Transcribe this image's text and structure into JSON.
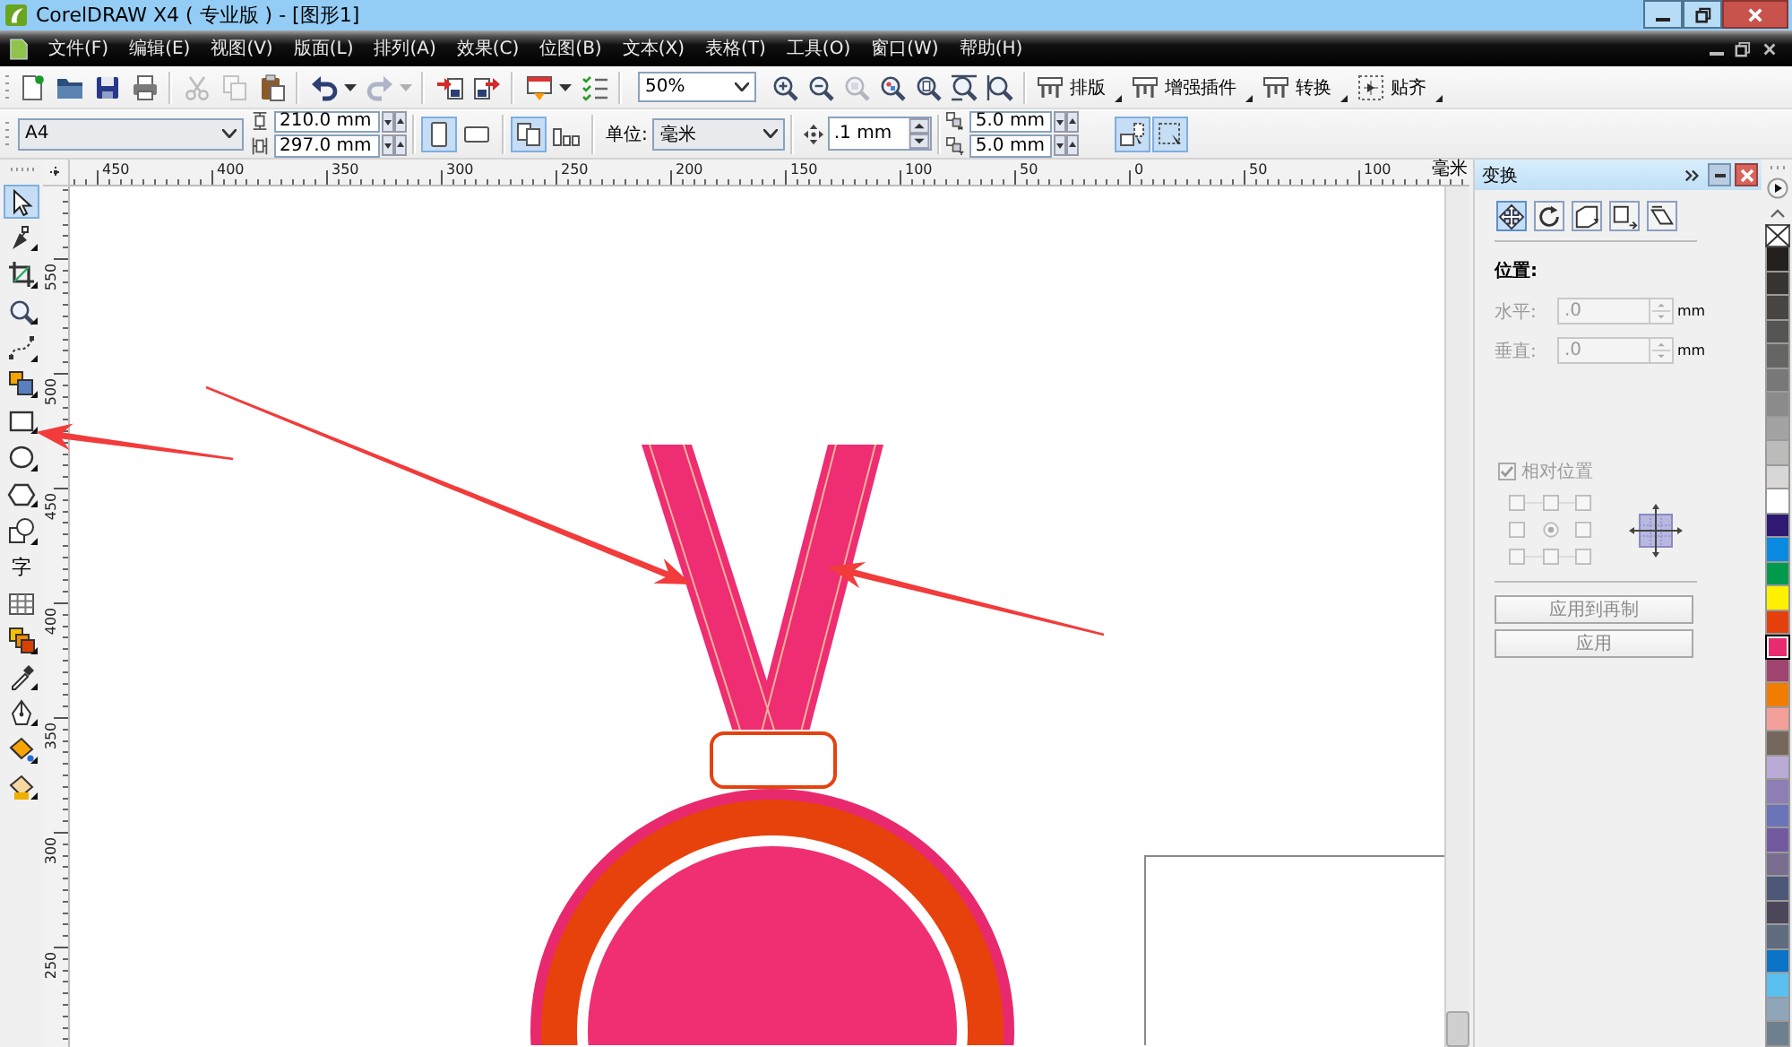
{
  "window": {
    "title": "CorelDRAW X4 ( 专业版 ) - [图形1]"
  },
  "menu_bar": {
    "items": [
      "文件(F)",
      "编辑(E)",
      "视图(V)",
      "版面(L)",
      "排列(A)",
      "效果(C)",
      "位图(B)",
      "文本(X)",
      "表格(T)",
      "工具(O)",
      "窗口(W)",
      "帮助(H)"
    ]
  },
  "standard_toolbar": {
    "groups": [
      [
        {
          "kind": "new",
          "disabled": false
        },
        {
          "kind": "open",
          "disabled": false
        },
        {
          "kind": "save",
          "disabled": false
        },
        {
          "kind": "print",
          "disabled": false
        }
      ],
      [
        {
          "kind": "cut",
          "disabled": true
        },
        {
          "kind": "copy",
          "disabled": true
        },
        {
          "kind": "paste",
          "disabled": false
        }
      ],
      [
        {
          "kind": "undo",
          "disabled": false
        },
        {
          "kind": "menu-caret",
          "disabled": false
        },
        {
          "kind": "redo",
          "disabled": true
        },
        {
          "kind": "menu-caret",
          "disabled": true
        }
      ],
      [
        {
          "kind": "import",
          "disabled": false
        },
        {
          "kind": "export",
          "disabled": false
        }
      ],
      [
        {
          "kind": "launcher",
          "disabled": false
        },
        {
          "kind": "menu-caret",
          "disabled": false
        },
        {
          "kind": "options",
          "disabled": false
        }
      ]
    ],
    "zoom_level": "50%",
    "zoom_tools": [
      {
        "kind": "zoom-in",
        "disabled": false
      },
      {
        "kind": "zoom-out",
        "disabled": false
      },
      {
        "kind": "zoom-selected",
        "disabled": true
      },
      {
        "kind": "zoom-all",
        "disabled": false
      },
      {
        "kind": "zoom-page",
        "disabled": false
      },
      {
        "kind": "zoom-width",
        "disabled": false
      },
      {
        "kind": "zoom-height",
        "disabled": false
      }
    ],
    "commands": [
      {
        "kind": "toolbar",
        "label": "排版"
      },
      {
        "kind": "toolbar",
        "label": "增强插件"
      },
      {
        "kind": "toolbar",
        "label": "转换"
      },
      {
        "kind": "snap",
        "label": "贴齐"
      }
    ]
  },
  "property_bar": {
    "page_size": "A4",
    "page_width": "210.0 mm",
    "page_height": "297.0 mm",
    "orientation": [
      {
        "kind": "portrait",
        "selected": true
      },
      {
        "kind": "landscape",
        "selected": false
      }
    ],
    "page_layout": [
      {
        "kind": "all-pages",
        "selected": true
      },
      {
        "kind": "current-page",
        "selected": false
      }
    ],
    "unit_label": "单位:",
    "unit": "毫米",
    "nudge": ".1 mm",
    "duplicate_x": "5.0 mm",
    "duplicate_y": "5.0 mm",
    "toggles": [
      {
        "kind": "object",
        "on": true
      },
      {
        "kind": "selection",
        "on": true
      }
    ]
  },
  "toolbox": {
    "tools": [
      {
        "kind": "pick",
        "selected": true,
        "flyout": false
      },
      {
        "kind": "shape",
        "selected": false,
        "flyout": true
      },
      {
        "kind": "crop",
        "selected": false,
        "flyout": true
      },
      {
        "kind": "zoom",
        "selected": false,
        "flyout": true
      },
      {
        "kind": "freehand",
        "selected": false,
        "flyout": true
      },
      {
        "kind": "smart-fill",
        "selected": false,
        "flyout": true
      },
      {
        "kind": "rectangle",
        "selected": false,
        "flyout": true
      },
      {
        "kind": "ellipse",
        "selected": false,
        "flyout": true
      },
      {
        "kind": "polygon",
        "selected": false,
        "flyout": true
      },
      {
        "kind": "basic-shapes",
        "selected": false,
        "flyout": true
      },
      {
        "kind": "text",
        "glyph": "字",
        "selected": false,
        "flyout": false
      },
      {
        "kind": "table",
        "selected": false,
        "flyout": false
      },
      {
        "kind": "blend",
        "selected": false,
        "flyout": true
      },
      {
        "kind": "eyedropper",
        "selected": false,
        "flyout": true
      },
      {
        "kind": "outline",
        "selected": false,
        "flyout": true
      },
      {
        "kind": "fill",
        "selected": false,
        "flyout": true
      },
      {
        "kind": "interactive-fill",
        "selected": false,
        "flyout": true
      }
    ]
  },
  "horizontal_ruler": {
    "labels": [
      "450",
      "400",
      "350",
      "300",
      "250",
      "200",
      "150",
      "100",
      "50",
      "0",
      "50",
      "100"
    ],
    "unit": "毫米"
  },
  "vertical_ruler": {
    "labels": [
      "550",
      "500",
      "450",
      "400",
      "350",
      "300",
      "250"
    ]
  },
  "docker": {
    "title": "变换",
    "tabs": [
      {
        "kind": "position",
        "selected": true
      },
      {
        "kind": "rotate",
        "selected": false
      },
      {
        "kind": "scale",
        "selected": false
      },
      {
        "kind": "size",
        "selected": false
      },
      {
        "kind": "skew",
        "selected": false
      }
    ],
    "section_title": "位置:",
    "fields": [
      {
        "label": "水平:",
        "value": ".0",
        "unit": "mm",
        "disabled": true
      },
      {
        "label": "垂直:",
        "value": ".0",
        "unit": "mm",
        "disabled": true
      }
    ],
    "relative_position": {
      "label": "相对位置",
      "checked": true,
      "disabled": true
    },
    "anchors": [
      {
        "selected": false
      },
      {
        "selected": false
      },
      {
        "selected": false
      },
      {
        "selected": false
      },
      {
        "selected": true
      },
      {
        "selected": false
      },
      {
        "selected": false
      },
      {
        "selected": false
      },
      {
        "selected": false
      }
    ],
    "buttons": [
      {
        "label": "应用到再制",
        "disabled": true
      },
      {
        "label": "应用",
        "disabled": true
      }
    ]
  },
  "color_palette": {
    "swatches": [
      {
        "color": "#23201e",
        "selected": false
      },
      {
        "color": "#373432",
        "selected": false
      },
      {
        "color": "#474442",
        "selected": false
      },
      {
        "color": "#575553",
        "selected": false
      },
      {
        "color": "#676564",
        "selected": false
      },
      {
        "color": "#7a7877",
        "selected": false
      },
      {
        "color": "#8c8b8a",
        "selected": false
      },
      {
        "color": "#a4a3a2",
        "selected": false
      },
      {
        "color": "#bcbbba",
        "selected": false
      },
      {
        "color": "#d8d7d6",
        "selected": false
      },
      {
        "color": "#ffffff",
        "selected": false
      },
      {
        "color": "#2e1a72",
        "selected": false
      },
      {
        "color": "#0a8ae0",
        "selected": false
      },
      {
        "color": "#009a4c",
        "selected": false
      },
      {
        "color": "#fff100",
        "selected": false
      },
      {
        "color": "#e6400c",
        "selected": false
      },
      {
        "color": "#e82a6e",
        "selected": true
      },
      {
        "color": "#a0436e",
        "selected": false
      },
      {
        "color": "#f07d00",
        "selected": false
      },
      {
        "color": "#f4a09a",
        "selected": false
      },
      {
        "color": "#75675c",
        "selected": false
      },
      {
        "color": "#b9abd6",
        "selected": false
      },
      {
        "color": "#8e7eb6",
        "selected": false
      },
      {
        "color": "#6b74b8",
        "selected": false
      },
      {
        "color": "#735aa0",
        "selected": false
      },
      {
        "color": "#7a6e90",
        "selected": false
      },
      {
        "color": "#4d5778",
        "selected": false
      },
      {
        "color": "#4c475a",
        "selected": false
      },
      {
        "color": "#5f6b7e",
        "selected": false
      },
      {
        "color": "#0b73c6",
        "selected": false
      },
      {
        "color": "#5bbff0",
        "selected": false
      },
      {
        "color": "#8fa6b9",
        "selected": false
      },
      {
        "color": "#6e7f8e",
        "selected": false
      }
    ]
  }
}
